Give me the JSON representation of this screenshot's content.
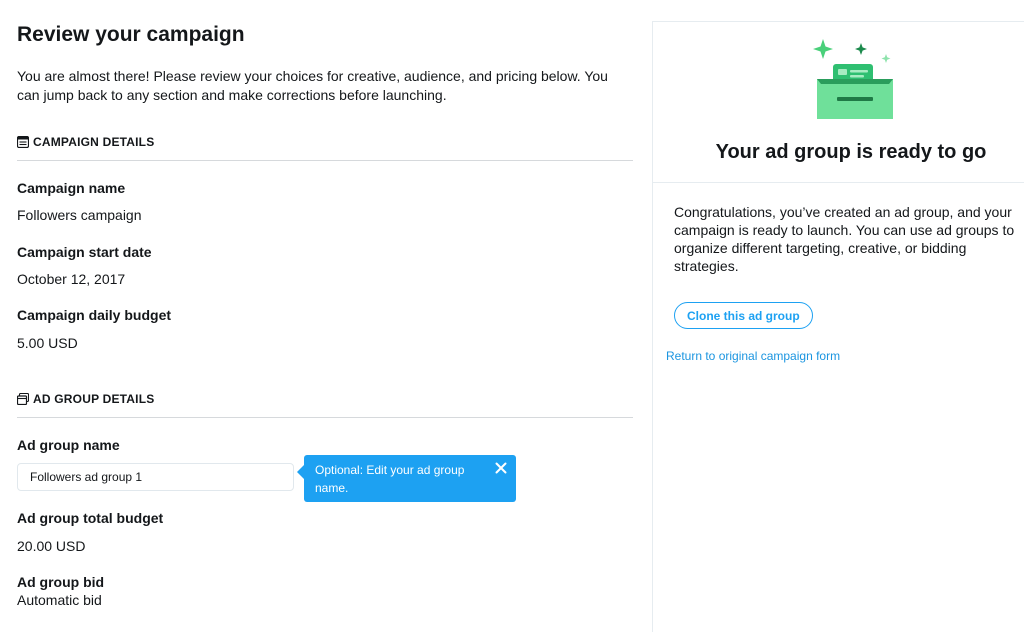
{
  "page": {
    "title": "Review your campaign",
    "intro": "You are almost there! Please review your choices for creative, audience, and pricing below. You can jump back to any section and make corrections before launching."
  },
  "campaign_section": {
    "header": "CAMPAIGN DETAILS",
    "icon": "campaign-list-icon",
    "fields": [
      {
        "label": "Campaign name",
        "value": "Followers campaign"
      },
      {
        "label": "Campaign start date",
        "value": "October 12, 2017"
      },
      {
        "label": "Campaign daily budget",
        "value": "5.00 USD"
      }
    ]
  },
  "adgroup_section": {
    "header": "AD GROUP DETAILS",
    "icon": "ad-group-icon",
    "name_label": "Ad group name",
    "name_value": "Followers ad group 1",
    "budget_label": "Ad group total budget",
    "budget_value": "20.00 USD",
    "bid_label": "Ad group bid",
    "bid_value": "Automatic bid"
  },
  "tooltip": {
    "text": "Optional: Edit your ad group name.",
    "close_icon": "close-icon"
  },
  "right_panel": {
    "illustration_icon": "ready-to-launch-illustration",
    "title": "Your ad group is ready to go",
    "body": "Congratulations, you’ve created an ad group, and your campaign is ready to launch. You can use ad groups to organize different targeting, creative, or bidding strategies.",
    "clone_button": "Clone this ad group",
    "return_link": "Return to original campaign form"
  },
  "colors": {
    "accent": "#1da1f2",
    "link": "#1b95e0",
    "text": "#14171a",
    "illustration_green": "#4ad07a"
  }
}
